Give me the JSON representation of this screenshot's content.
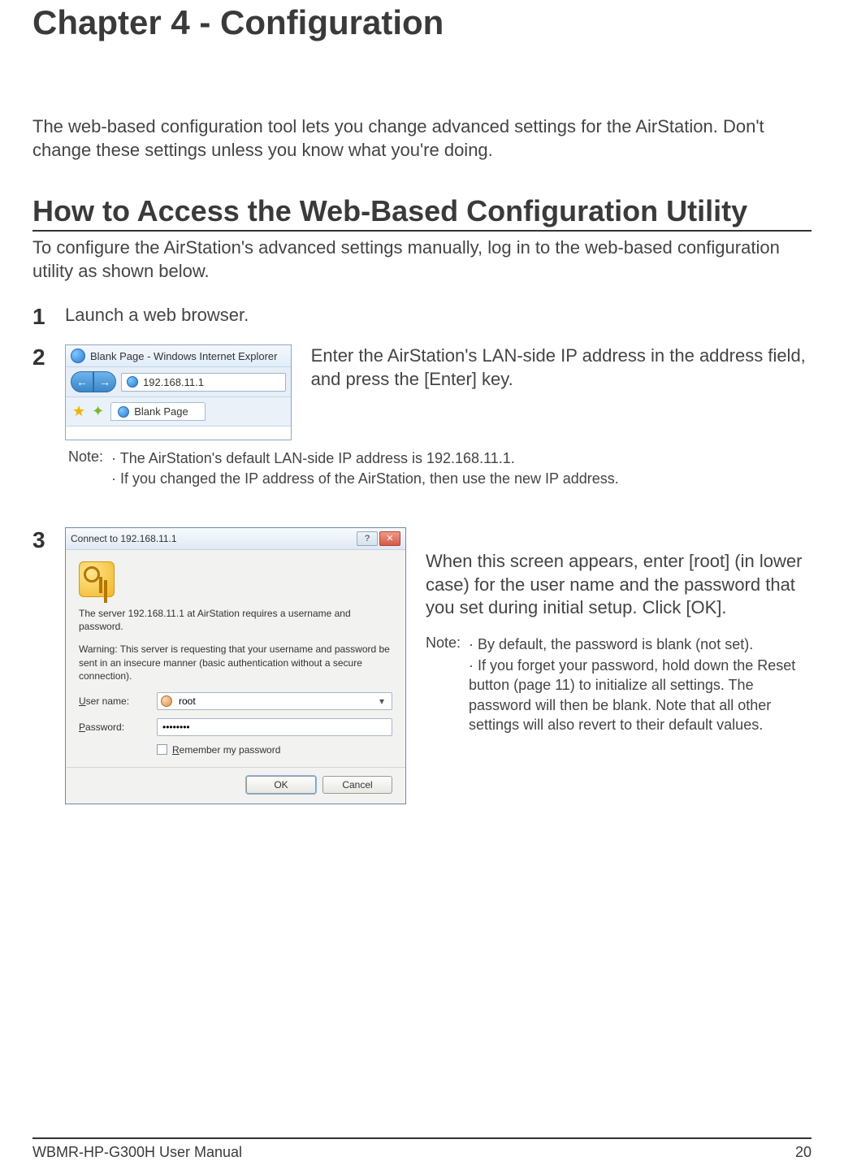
{
  "chapter_title": "Chapter 4 - Configuration",
  "intro": "The web-based configuration tool lets you change advanced settings for the AirStation. Don't change these settings unless you know what you're doing.",
  "section_title": "How to Access the Web-Based Configuration Utility",
  "section_intro": "To configure the AirStation's advanced  settings manually, log in to the web-based configuration utility as shown below.",
  "steps": {
    "s1": {
      "num": "1",
      "text": "Launch a web browser."
    },
    "s2": {
      "num": "2",
      "text": "Enter the AirStation's LAN-side IP address in the address field, and press the [Enter] key.",
      "browser": {
        "title": "Blank Page - Windows Internet Explorer",
        "address": "192.168.11.1",
        "tab": "Blank Page"
      },
      "note_label": "Note:",
      "notes": [
        "· The AirStation's default LAN-side IP address is 192.168.11.1.",
        "· If you changed the IP address of the AirStation, then use the new IP address."
      ]
    },
    "s3": {
      "num": "3",
      "text": "When this screen appears, enter [root] (in lower case) for the user name and the password that you set during initial setup. Click [OK].",
      "dialog": {
        "title": "Connect to 192.168.11.1",
        "msg1": "The server 192.168.11.1 at AirStation requires a username and password.",
        "msg2": "Warning: This server is requesting that your username and password be sent in an insecure manner (basic authentication without a secure connection).",
        "user_label": "User name:",
        "user_value": "root",
        "pass_label": "Password:",
        "pass_value": "••••••••",
        "remember": "Remember my password",
        "ok": "OK",
        "cancel": "Cancel"
      },
      "note_label": "Note:",
      "notes": [
        "· By default, the password is blank (not set).",
        "· If you forget your password, hold down the  Reset button (page 11) to initialize all settings. The password will then be blank. Note that all other settings will also revert to their default values."
      ]
    }
  },
  "footer": {
    "manual": "WBMR-HP-G300H User Manual",
    "page": "20"
  }
}
